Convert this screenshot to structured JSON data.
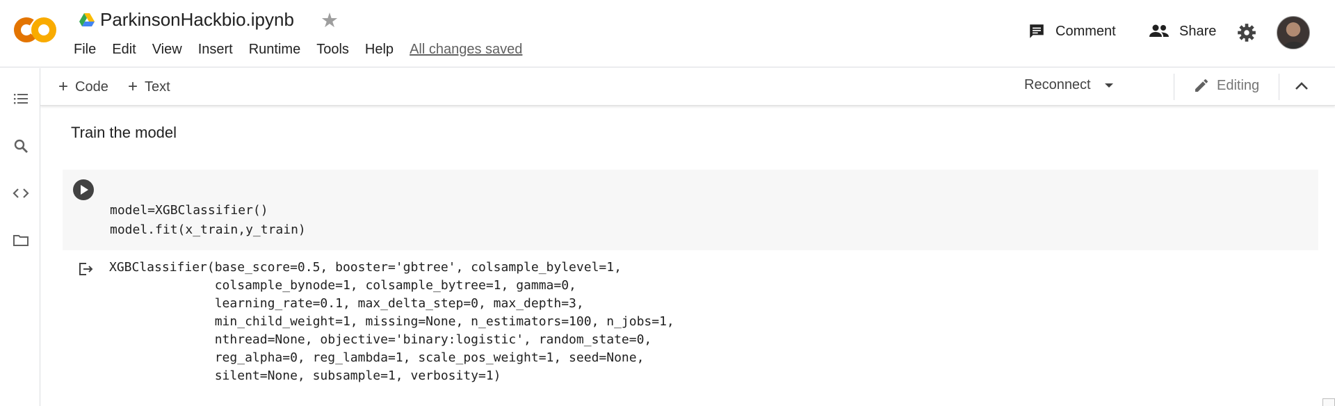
{
  "header": {
    "logo_text": "CO",
    "title": "ParkinsonHackbio.ipynb",
    "menu": [
      "File",
      "Edit",
      "View",
      "Insert",
      "Runtime",
      "Tools",
      "Help"
    ],
    "save_status": "All changes saved",
    "comment_label": "Comment",
    "share_label": "Share"
  },
  "toolbar": {
    "add_code_label": "Code",
    "add_text_label": "Text",
    "connect_label": "Reconnect",
    "mode_label": "Editing"
  },
  "notebook": {
    "text_cell": "Train the model",
    "code_lines": [
      "model=XGBClassifier()",
      "model.fit(x_train,y_train)"
    ],
    "output_lines": [
      "XGBClassifier(base_score=0.5, booster='gbtree', colsample_bylevel=1,",
      "              colsample_bynode=1, colsample_bytree=1, gamma=0,",
      "              learning_rate=0.1, max_delta_step=0, max_depth=3,",
      "              min_child_weight=1, missing=None, n_estimators=100, n_jobs=1,",
      "              nthread=None, objective='binary:logistic', random_state=0,",
      "              reg_alpha=0, reg_lambda=1, scale_pos_weight=1, seed=None,",
      "              silent=None, subsample=1, verbosity=1)"
    ]
  },
  "icons": {
    "logo": "colab-logo",
    "drive": "google-drive-icon",
    "star": "star-icon",
    "comment": "comment-icon",
    "share": "people-icon",
    "settings": "gear-icon",
    "sidebar": [
      "table-of-contents-icon",
      "search-icon",
      "code-snippets-icon",
      "folder-icon"
    ],
    "run": "play-icon",
    "output": "output-icon"
  },
  "colors": {
    "logo_orange": "#f9ab00",
    "logo_orange_dark": "#e37400",
    "cell_background": "#f7f7f7",
    "run_button": "#424242"
  }
}
